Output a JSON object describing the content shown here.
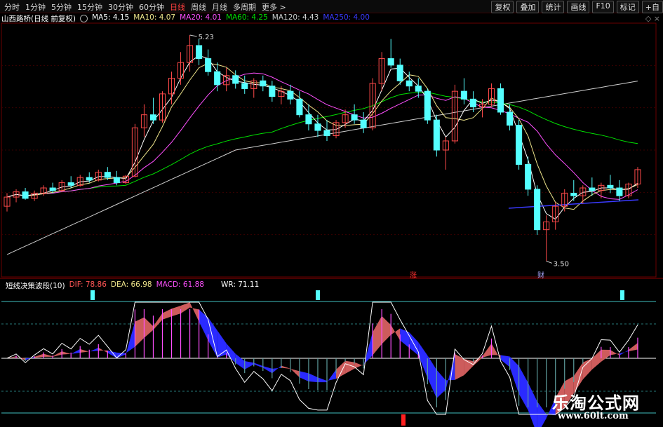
{
  "toolbar": {
    "periods": [
      "分时",
      "1分钟",
      "5分钟",
      "15分钟",
      "30分钟",
      "60分钟",
      "日线",
      "周线",
      "月线",
      "多周期",
      "更多 >"
    ],
    "active_period": "日线",
    "right_buttons": [
      "复权",
      "叠加",
      "统计",
      "画线",
      "F10",
      "标记",
      "+自"
    ]
  },
  "main_legend": {
    "stock": "山西路桥(日线 前复权)",
    "ma5": "MA5: 4.15",
    "ma10": "MA10: 4.07",
    "ma20": "MA20: 4.01",
    "ma60": "MA60: 4.25",
    "ma120": "MA120: 4.43",
    "ma250": "MA250: 4.00"
  },
  "price_labels": {
    "high": "5.23",
    "low": "3.50",
    "mark_zhang": "涨",
    "mark_cai": "财"
  },
  "indicator_legend": {
    "name": "短线决策波段(10)",
    "dif": "DIF: 78.86",
    "dea": "DEA: 66.98",
    "macd": "MACD: 61.88",
    "wr": "WR: 71.11"
  },
  "watermark": {
    "cn": "乐淘公式网",
    "url": "www.60lt.com"
  },
  "colors": {
    "up": "#ff4a4a",
    "down": "#54ffff",
    "ma5": "#ffffff",
    "ma10": "#f0e68c",
    "ma20": "#ff50ff",
    "ma60": "#00e000",
    "ma120": "#cfcfcf",
    "ma250": "#3a3aff",
    "fill_red": "#cd5c5c",
    "fill_blue": "#2a2aff"
  },
  "chart_data": {
    "type": "candlestick",
    "price_high": 5.23,
    "price_low": 3.5,
    "candles": [
      [
        3.92,
        4.02,
        3.88,
        3.99
      ],
      [
        3.99,
        4.05,
        3.95,
        4.03
      ],
      [
        4.03,
        4.06,
        3.97,
        3.98
      ],
      [
        3.98,
        4.04,
        3.96,
        4.02
      ],
      [
        4.02,
        4.08,
        4.0,
        4.06
      ],
      [
        4.06,
        4.1,
        4.02,
        4.04
      ],
      [
        4.04,
        4.12,
        4.03,
        4.1
      ],
      [
        4.1,
        4.15,
        4.06,
        4.08
      ],
      [
        4.08,
        4.16,
        4.07,
        4.14
      ],
      [
        4.14,
        4.18,
        4.1,
        4.12
      ],
      [
        4.12,
        4.2,
        4.11,
        4.18
      ],
      [
        4.18,
        4.22,
        4.12,
        4.14
      ],
      [
        4.14,
        4.19,
        4.08,
        4.1
      ],
      [
        4.1,
        4.16,
        4.09,
        4.15
      ],
      [
        4.15,
        4.55,
        4.14,
        4.52
      ],
      [
        4.52,
        4.7,
        4.45,
        4.62
      ],
      [
        4.62,
        4.75,
        4.55,
        4.58
      ],
      [
        4.58,
        4.8,
        4.56,
        4.78
      ],
      [
        4.78,
        4.95,
        4.7,
        4.9
      ],
      [
        4.9,
        5.1,
        4.85,
        5.02
      ],
      [
        5.02,
        5.23,
        4.95,
        5.15
      ],
      [
        5.15,
        5.2,
        5.0,
        5.05
      ],
      [
        5.05,
        5.12,
        4.92,
        4.95
      ],
      [
        4.95,
        5.02,
        4.8,
        4.85
      ],
      [
        4.85,
        4.98,
        4.8,
        4.92
      ],
      [
        4.92,
        4.96,
        4.82,
        4.86
      ],
      [
        4.86,
        4.92,
        4.78,
        4.82
      ],
      [
        4.82,
        4.9,
        4.75,
        4.88
      ],
      [
        4.88,
        4.92,
        4.8,
        4.84
      ],
      [
        4.84,
        4.88,
        4.72,
        4.76
      ],
      [
        4.76,
        4.84,
        4.7,
        4.8
      ],
      [
        4.8,
        4.85,
        4.7,
        4.74
      ],
      [
        4.74,
        4.8,
        4.6,
        4.62
      ],
      [
        4.62,
        4.7,
        4.5,
        4.55
      ],
      [
        4.55,
        4.62,
        4.45,
        4.5
      ],
      [
        4.5,
        4.58,
        4.42,
        4.46
      ],
      [
        4.46,
        4.58,
        4.44,
        4.56
      ],
      [
        4.56,
        4.66,
        4.52,
        4.62
      ],
      [
        4.62,
        4.7,
        4.55,
        4.58
      ],
      [
        4.58,
        4.64,
        4.48,
        4.52
      ],
      [
        4.52,
        4.9,
        4.5,
        4.86
      ],
      [
        4.86,
        5.1,
        4.8,
        5.05
      ],
      [
        5.05,
        5.2,
        4.98,
        5.0
      ],
      [
        5.0,
        5.05,
        4.85,
        4.88
      ],
      [
        4.88,
        4.95,
        4.8,
        4.84
      ],
      [
        4.84,
        4.9,
        4.75,
        4.8
      ],
      [
        4.8,
        4.82,
        4.55,
        4.58
      ],
      [
        4.58,
        4.62,
        4.3,
        4.35
      ],
      [
        4.35,
        4.45,
        4.2,
        4.42
      ],
      [
        4.42,
        4.85,
        4.4,
        4.8
      ],
      [
        4.8,
        4.9,
        4.7,
        4.74
      ],
      [
        4.74,
        4.8,
        4.64,
        4.68
      ],
      [
        4.68,
        4.74,
        4.6,
        4.7
      ],
      [
        4.7,
        4.86,
        4.68,
        4.82
      ],
      [
        4.82,
        4.86,
        4.62,
        4.64
      ],
      [
        4.64,
        4.7,
        4.5,
        4.54
      ],
      [
        4.54,
        4.58,
        4.2,
        4.24
      ],
      [
        4.24,
        4.3,
        4.0,
        4.05
      ],
      [
        4.05,
        4.08,
        3.7,
        3.74
      ],
      [
        3.74,
        3.85,
        3.5,
        3.8
      ],
      [
        3.8,
        3.95,
        3.74,
        3.92
      ],
      [
        3.92,
        4.05,
        3.88,
        4.02
      ],
      [
        4.02,
        4.12,
        3.96,
        4.0
      ],
      [
        4.0,
        4.08,
        3.94,
        4.06
      ],
      [
        4.06,
        4.14,
        4.0,
        4.04
      ],
      [
        4.04,
        4.1,
        3.98,
        4.08
      ],
      [
        4.08,
        4.16,
        4.02,
        4.06
      ],
      [
        4.06,
        4.12,
        3.96,
        4.0
      ],
      [
        4.0,
        4.1,
        3.98,
        4.09
      ],
      [
        4.09,
        4.22,
        4.06,
        4.2
      ]
    ]
  }
}
